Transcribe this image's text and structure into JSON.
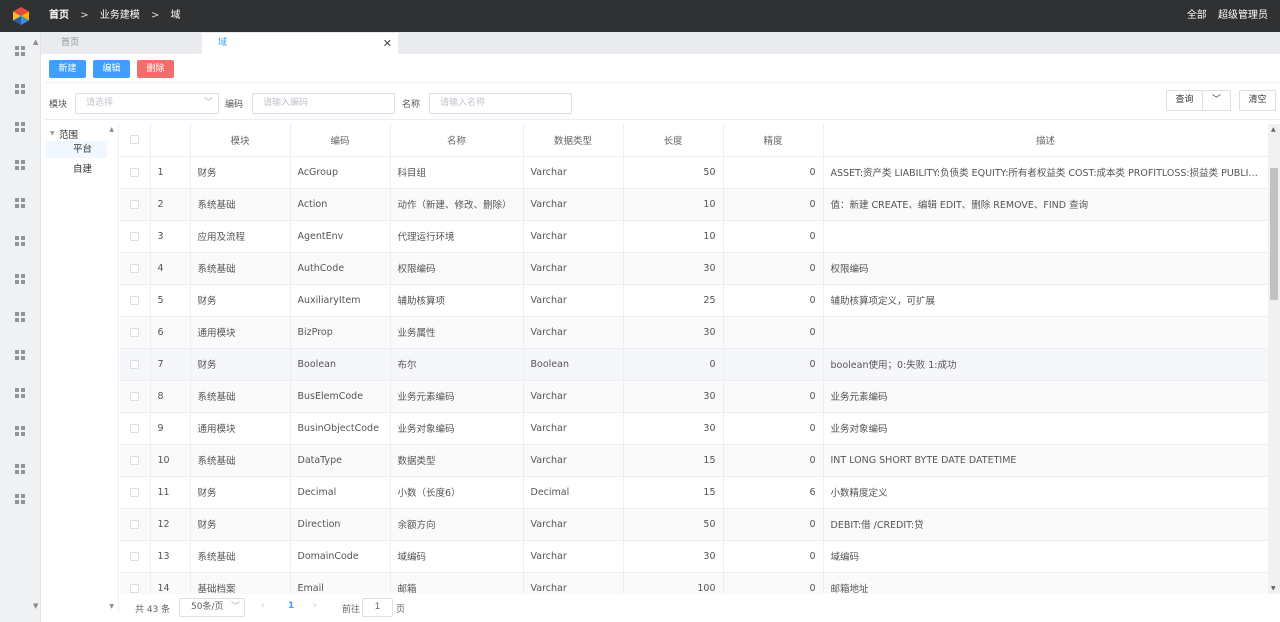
{
  "header": {
    "breadcrumb": [
      "首页",
      "业务建模",
      "域"
    ],
    "scope": "全部",
    "user": "超级管理员"
  },
  "tabs": [
    {
      "label": "首页"
    },
    {
      "label": "域"
    }
  ],
  "toolbar": {
    "new": "新建",
    "edit": "编辑",
    "delete": "删除"
  },
  "filter": {
    "module_label": "模块",
    "module_placeholder": "请选择",
    "code_label": "编码",
    "code_placeholder": "请输入编码",
    "name_label": "名称",
    "name_placeholder": "请输入名称",
    "query": "查询",
    "clear": "清空"
  },
  "tree": {
    "root": "范围",
    "children": [
      "平台",
      "自建"
    ]
  },
  "table": {
    "columns": [
      "模块",
      "编码",
      "名称",
      "数据类型",
      "长度",
      "精度",
      "描述"
    ],
    "rows": [
      [
        "1",
        "财务",
        "AcGroup",
        "科目组",
        "Varchar",
        "50",
        "0",
        "ASSET:资产类 LIABILITY:负债类 EQUITY:所有者权益类 COST:成本类 PROFITLOSS:损益类 PUBLIC:公..."
      ],
      [
        "2",
        "系统基础",
        "Action",
        "动作（新建、修改、删除）",
        "Varchar",
        "10",
        "0",
        "值：新建 CREATE、编辑 EDIT、删除 REMOVE、FIND 查询"
      ],
      [
        "3",
        "应用及流程",
        "AgentEnv",
        "代理运行环境",
        "Varchar",
        "10",
        "0",
        ""
      ],
      [
        "4",
        "系统基础",
        "AuthCode",
        "权限编码",
        "Varchar",
        "30",
        "0",
        "权限编码"
      ],
      [
        "5",
        "财务",
        "AuxiliaryItem",
        "辅助核算项",
        "Varchar",
        "25",
        "0",
        "辅助核算项定义，可扩展"
      ],
      [
        "6",
        "通用模块",
        "BizProp",
        "业务属性",
        "Varchar",
        "30",
        "0",
        ""
      ],
      [
        "7",
        "财务",
        "Boolean",
        "布尔",
        "Boolean",
        "0",
        "0",
        "boolean使用；0:失败 1:成功"
      ],
      [
        "8",
        "系统基础",
        "BusElemCode",
        "业务元素编码",
        "Varchar",
        "30",
        "0",
        "业务元素编码"
      ],
      [
        "9",
        "通用模块",
        "BusinObjectCode",
        "业务对象编码",
        "Varchar",
        "30",
        "0",
        "业务对象编码"
      ],
      [
        "10",
        "系统基础",
        "DataType",
        "数据类型",
        "Varchar",
        "15",
        "0",
        "INT LONG SHORT BYTE DATE DATETIME"
      ],
      [
        "11",
        "财务",
        "Decimal",
        "小数（长度6）",
        "Decimal",
        "15",
        "6",
        "小数精度定义"
      ],
      [
        "12",
        "财务",
        "Direction",
        "余额方向",
        "Varchar",
        "50",
        "0",
        "DEBIT:借 /CREDIT:贷"
      ],
      [
        "13",
        "系统基础",
        "DomainCode",
        "域编码",
        "Varchar",
        "30",
        "0",
        "域编码"
      ],
      [
        "14",
        "基础档案",
        "Email",
        "邮箱",
        "Varchar",
        "100",
        "0",
        "邮箱地址"
      ]
    ]
  },
  "pager": {
    "total": "共 43 条",
    "page_size": "50条/页",
    "current_page": "1",
    "goto_label": "前往",
    "goto_value": "1",
    "page_word": "页"
  },
  "colors": {
    "primary": "#409eff",
    "danger": "#f56c6c",
    "header_bg": "#303133"
  }
}
